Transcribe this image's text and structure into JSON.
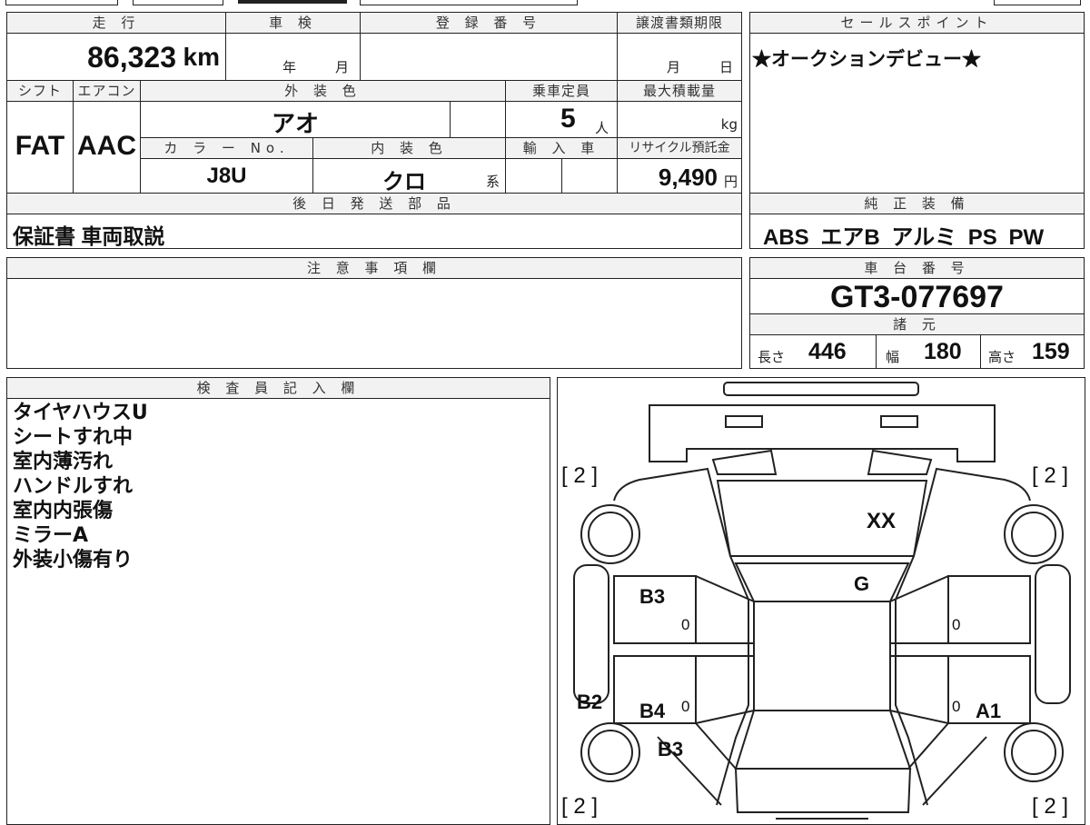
{
  "vehicle": {
    "mileage_label": "走 行",
    "mileage_value": "86,323",
    "mileage_unit": "km",
    "shaken_label": "車 検",
    "shaken_year_unit": "年",
    "shaken_month_unit": "月",
    "registration_label": "登 録 番 号",
    "transfer_label": "譲渡書類期限",
    "transfer_month_unit": "月",
    "transfer_day_unit": "日",
    "shift_label": "シフト",
    "shift_value": "FAT",
    "aircon_label": "エアコン",
    "aircon_value": "AAC",
    "exterior_color_label": "外 装 色",
    "exterior_color_value": "アオ",
    "capacity_label": "乗車定員",
    "capacity_value": "5",
    "capacity_unit": "人",
    "max_load_label": "最大積載量",
    "max_load_unit": "kg",
    "color_no_label": "カ ラ ー No.",
    "color_no_value": "J8U",
    "interior_color_label": "内 装 色",
    "interior_color_value": "クロ",
    "interior_color_suffix": "系",
    "import_label": "輸 入 車",
    "recycle_label": "リサイクル預託金",
    "recycle_value": "9,490",
    "recycle_unit": "円",
    "later_parts_label": "後 日 発 送 部 品",
    "later_parts_value": "保証書 車両取説"
  },
  "sales_point": {
    "label": "セールスポイント",
    "value": "★オークションデビュー★"
  },
  "equipment": {
    "label": "純 正 装 備",
    "value": "ABS エアB アルミ PS PW"
  },
  "caution": {
    "label": "注 意 事 項 欄"
  },
  "chassis": {
    "label": "車 台 番 号",
    "value": "GT3-077697"
  },
  "specs": {
    "label": "諸 元",
    "length_label": "長さ",
    "length_value": "446",
    "width_label": "幅",
    "width_value": "180",
    "height_label": "高さ",
    "height_value": "159"
  },
  "inspector": {
    "label": "検 査 員 記 入 欄",
    "notes": [
      "タイヤハウスU",
      "シートすれ中",
      "室内薄汚れ",
      "ハンドルすれ",
      "室内内張傷",
      "ミラーA",
      "外装小傷有り"
    ]
  },
  "diagram": {
    "tire_tl": "[ 2 ]",
    "tire_tr": "[ 2 ]",
    "tire_bl": "[ 2 ]",
    "tire_br": "[ 2 ]",
    "mark_hood": "XX",
    "mark_windshield": "G",
    "mark_left_front_door": "B3",
    "mark_left_rear_door": "B4",
    "mark_left_rear_fender": "B3",
    "mark_left_panel": "B2",
    "mark_right_rear_door": "A1",
    "zero_lf": "0",
    "zero_lr": "0",
    "zero_rf": "0",
    "zero_rr": "0"
  }
}
